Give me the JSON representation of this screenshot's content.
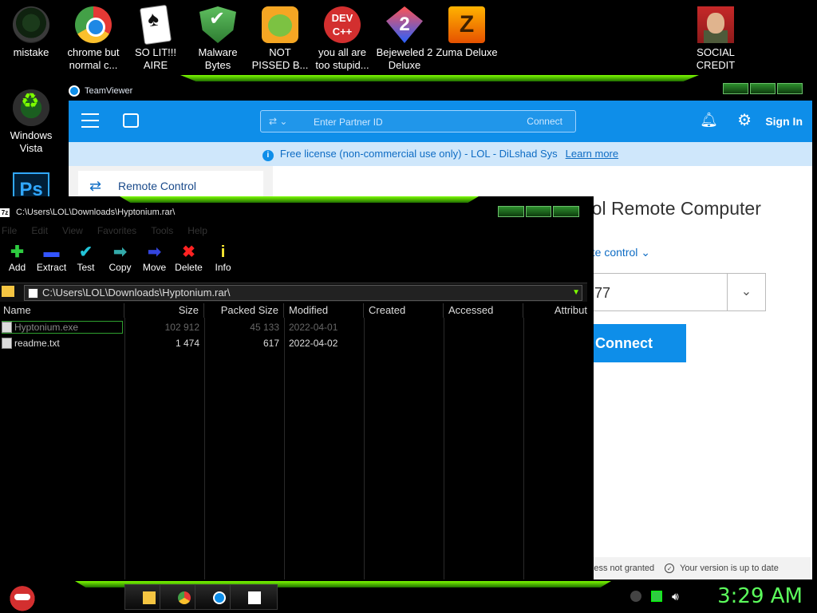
{
  "desktop_icons": [
    {
      "label": "mistake",
      "icon": "mistake-icon"
    },
    {
      "label": "chrome but normal c...",
      "icon": "chrome-icon"
    },
    {
      "label": "SO LIT!!! AIRE",
      "icon": "solitaire-icon"
    },
    {
      "label": "Malware Bytes",
      "icon": "malwarebytes-icon"
    },
    {
      "label": "NOT PISSED B...",
      "icon": "angry-pig-icon"
    },
    {
      "label": "you all are too stupid...",
      "icon": "devcpp-icon"
    },
    {
      "label": "Bejeweled 2 Deluxe",
      "icon": "bejeweled-icon"
    },
    {
      "label": "Zuma Deluxe",
      "icon": "zuma-icon"
    },
    {
      "label": "SOCIAL CREDIT",
      "icon": "social-credit-icon"
    },
    {
      "label": "Windows Vista",
      "icon": "recycle-icon"
    },
    {
      "label": "Ps",
      "icon": "photoshop-icon"
    }
  ],
  "teamviewer": {
    "title": "TeamViewer",
    "partner_placeholder": "Enter Partner ID",
    "connect_small": "Connect",
    "sign_in": "Sign In",
    "notice": "Free license (non-commercial use only) - LOL - DiLshad Sys",
    "learn_more": "Learn more",
    "sidebar_item": "Remote Control",
    "main_title": "rol Remote Computer",
    "mode": "ote control",
    "partner_id_value": "77",
    "connect_button": "Connect",
    "status_access": "Access not granted",
    "status_version": "Your version is up to date",
    "accent": "#0e8ee9"
  },
  "zip": {
    "title": "C:\\Users\\LOL\\Downloads\\Hyptonium.rar\\",
    "menu": [
      "File",
      "Edit",
      "View",
      "Favorites",
      "Tools",
      "Help"
    ],
    "toolbar": [
      {
        "label": "Add",
        "icon": "add-icon",
        "glyph": "✚",
        "color": "#2ecc40"
      },
      {
        "label": "Extract",
        "icon": "extract-icon",
        "glyph": "▬",
        "color": "#3355ff"
      },
      {
        "label": "Test",
        "icon": "test-icon",
        "glyph": "✔",
        "color": "#22c4d8"
      },
      {
        "label": "Copy",
        "icon": "copy-icon",
        "glyph": "➡",
        "color": "#33aaaa"
      },
      {
        "label": "Move",
        "icon": "move-icon",
        "glyph": "➡",
        "color": "#3344dd"
      },
      {
        "label": "Delete",
        "icon": "delete-icon",
        "glyph": "✖",
        "color": "#ff2222"
      },
      {
        "label": "Info",
        "icon": "info-icon",
        "glyph": "i",
        "color": "#ffee33"
      }
    ],
    "address": "C:\\Users\\LOL\\Downloads\\Hyptonium.rar\\",
    "columns": [
      "Name",
      "Size",
      "Packed Size",
      "Modified",
      "Created",
      "Accessed",
      "Attribut"
    ],
    "rows": [
      {
        "name": "Hyptonium.exe",
        "size": "102 912",
        "packed": "45 133",
        "modified": "2022-04-01"
      },
      {
        "name": "readme.txt",
        "size": "1 474",
        "packed": "617",
        "modified": "2022-04-02"
      }
    ]
  },
  "taskbar": {
    "clock": "3:29 AM",
    "apps": [
      "explorer-icon",
      "chrome-icon",
      "teamviewer-icon",
      "7zip-icon"
    ]
  }
}
